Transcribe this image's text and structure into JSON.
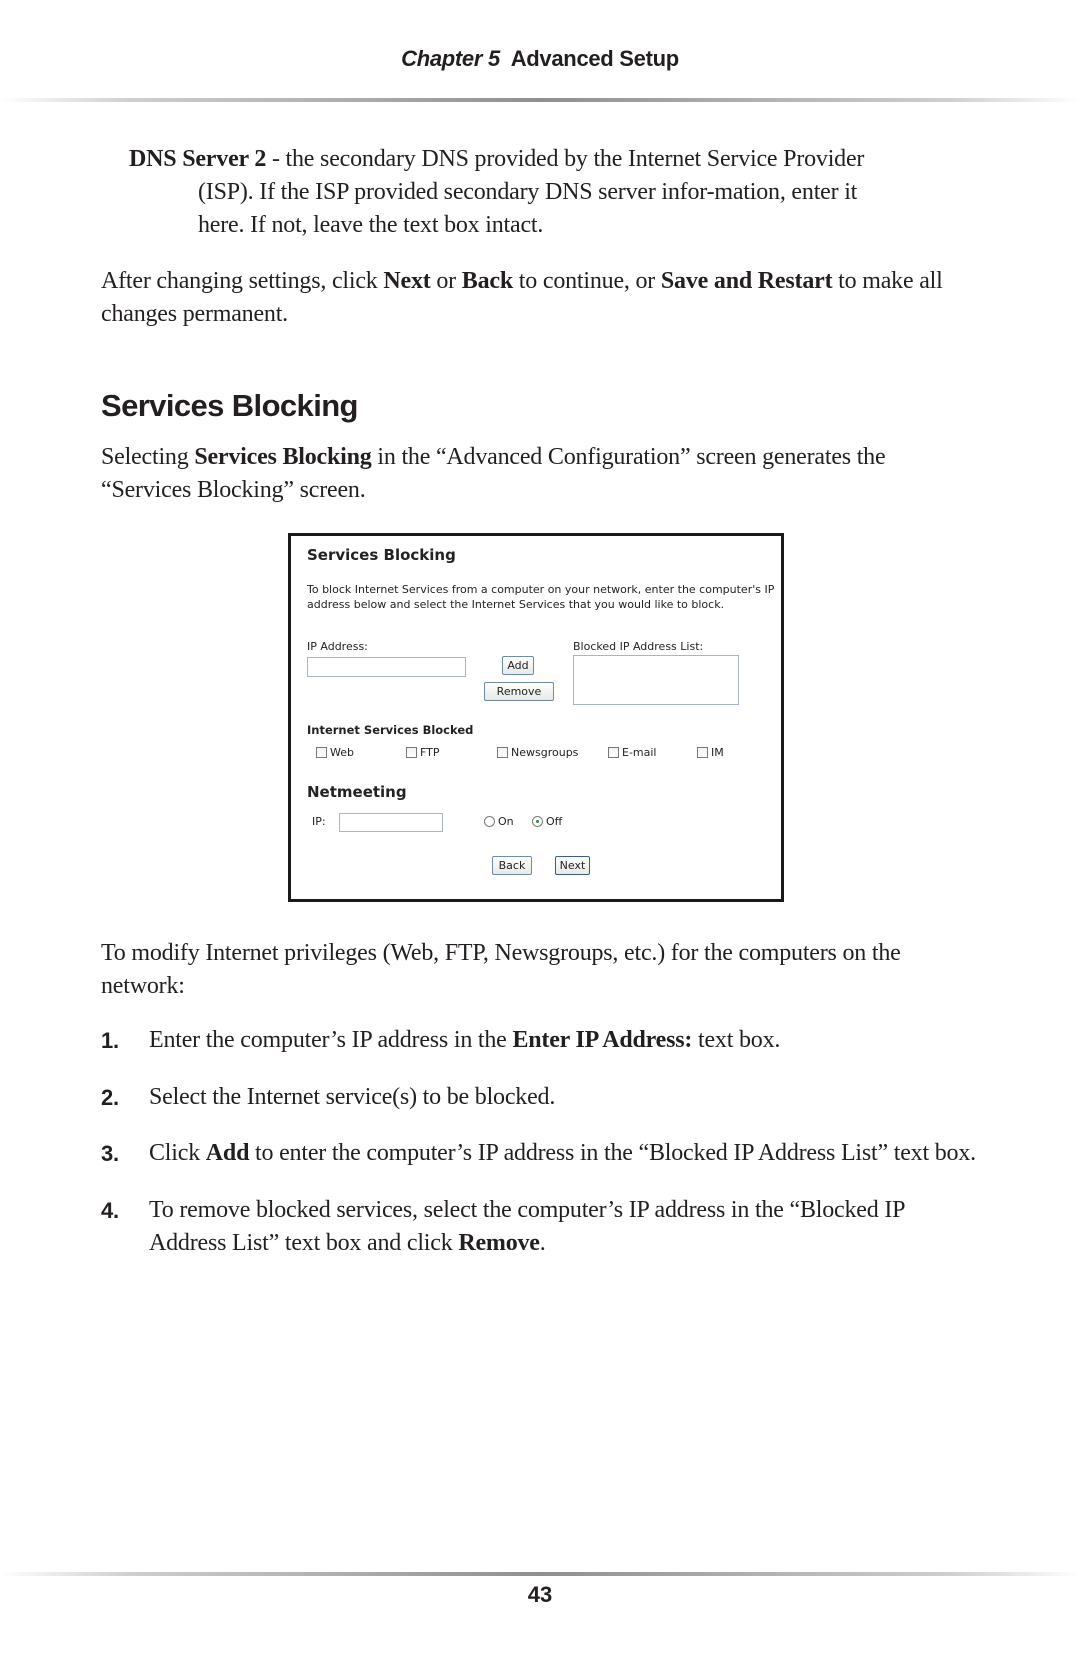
{
  "header": {
    "chapter": "Chapter 5",
    "title": "Advanced Setup"
  },
  "definition": {
    "term": "DNS Server 2",
    "text": " - the secondary DNS provided by the Internet Service Provider (ISP). If the ISP provided secondary DNS server infor-mation, enter it here. If not, leave the text box intact."
  },
  "after_paragraph": {
    "p1": "After changing settings, click ",
    "next": "Next",
    "p2": " or ",
    "back": "Back",
    "p3": " to continue, or ",
    "save": "Save and Restart",
    "p4": " to make all changes permanent."
  },
  "section": {
    "title": "Services Blocking",
    "intro_p1": "Selecting ",
    "intro_bold": "Services Blocking",
    "intro_p2": " in the “Advanced Configuration” screen generates the “Services Blocking” screen."
  },
  "screenshot": {
    "title": "Services Blocking",
    "description": "To block Internet Services from a computer on your network, enter the computer's IP address below and select the Internet Services that you would like to block.",
    "ip_label": "IP Address:",
    "ip_value": "",
    "blocked_list_label": "Blocked IP Address List:",
    "add_button": "Add",
    "remove_button": "Remove",
    "services_heading": "Internet Services Blocked",
    "services": [
      {
        "label": "Web",
        "checked": false
      },
      {
        "label": "FTP",
        "checked": false
      },
      {
        "label": "Newsgroups",
        "checked": false
      },
      {
        "label": "E-mail",
        "checked": false
      },
      {
        "label": "IM",
        "checked": false
      }
    ],
    "netmeeting_heading": "Netmeeting",
    "netmeeting_ip_label": "IP:",
    "netmeeting_ip_value": "",
    "radio_on": "On",
    "radio_off": "Off",
    "radio_selected": "Off",
    "back_button": "Back",
    "next_button": "Next"
  },
  "modify_paragraph": "To modify Internet privileges (Web, FTP, Newsgroups, etc.) for the computers on the network:",
  "steps": [
    {
      "num": "1.",
      "a": "Enter the computer’s IP address in the ",
      "b": "Enter IP Address:",
      "c": " text box."
    },
    {
      "num": "2.",
      "a": "Select the Internet service(s) to be blocked.",
      "b": "",
      "c": ""
    },
    {
      "num": "3.",
      "a": "Click ",
      "b": "Add",
      "c": " to enter the computer’s IP address in the “Blocked IP Address List” text box."
    },
    {
      "num": "4.",
      "a": "To remove blocked services, select the computer’s IP address in the “Blocked IP Address List” text box and click ",
      "b": "Remove",
      "c": "."
    }
  ],
  "page_number": "43"
}
